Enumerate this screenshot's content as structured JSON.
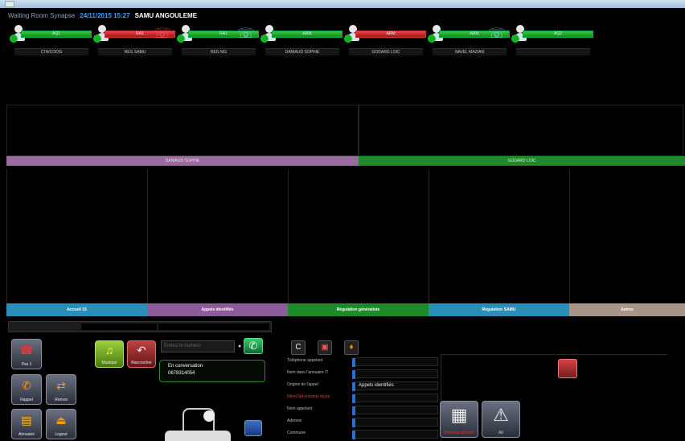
{
  "window": {
    "app_icon": "window-icon"
  },
  "header": {
    "room": "Waiting Room Synapse",
    "datetime": "24/11/2015 15:27",
    "center": "SAMU ANGOULEME"
  },
  "agents": [
    {
      "bar_label": "AQ1",
      "name": "CTA/CODIS",
      "status_color": "#1f9e1f",
      "phone_icon": ""
    },
    {
      "bar_label": "RA1",
      "name": "REG SAMU",
      "status_color": "#c02020",
      "phone_icon": "handset-icon"
    },
    {
      "bar_label": "RA1",
      "name": "REG MG",
      "status_color": "#1f9e1f",
      "phone_icon": "handset-icon"
    },
    {
      "bar_label": "ARM",
      "name": "DANIAUD SOPHIE",
      "status_color": "#1f9e1f",
      "phone_icon": ""
    },
    {
      "bar_label": "ARM",
      "name": "GODARD LOIC",
      "status_color": "#c02020",
      "phone_icon": ""
    },
    {
      "bar_label": "ARM",
      "name": "NAVEL MAZIAN",
      "status_color": "#1f9e1f",
      "phone_icon": "handset-icon"
    },
    {
      "bar_label": "AQ2",
      "name": "",
      "status_color": "#1f9e1f",
      "phone_icon": ""
    }
  ],
  "group_bars": [
    {
      "label": "DANIAUD SOPHIE",
      "color": "#9a6aa0"
    },
    {
      "label": "GODARD LOIC",
      "color": "#1e8a2a"
    }
  ],
  "queues": [
    {
      "label": "Accueil 15",
      "color": "#2a8fb8"
    },
    {
      "label": "Appels identifiés",
      "color": "#8c5c9a"
    },
    {
      "label": "Régulation généraliste",
      "color": "#1e8a2a"
    },
    {
      "label": "Régulation SAMU",
      "color": "#2a8fb8"
    },
    {
      "label": "Autres",
      "color": "#a8958a"
    }
  ],
  "left_buttons": [
    {
      "label": "Pas 1",
      "icon": "headset-icon"
    },
    {
      "label": "Rappel",
      "icon": "phone-icon"
    },
    {
      "label": "Renvoi",
      "icon": "transfer-icon"
    },
    {
      "label": "Annuaire",
      "icon": "directory-icon"
    },
    {
      "label": "Logout",
      "icon": "logout-icon"
    }
  ],
  "call_buttons": [
    {
      "label": "Musique",
      "icon": "music-icon"
    },
    {
      "label": "Raccrocher",
      "icon": "hangup-icon"
    }
  ],
  "dialer": {
    "placeholder": "Entrez le numéro"
  },
  "conversation": {
    "status": "En conversation",
    "number": "0678314054"
  },
  "toolbar": {
    "tools": [
      {
        "icon": "c-icon",
        "glyph": "C"
      },
      {
        "icon": "card-icon",
        "glyph": "▣"
      },
      {
        "icon": "person-alert-icon",
        "glyph": "♦"
      }
    ]
  },
  "form": {
    "fields": [
      {
        "label": "Téléphone appelant",
        "value": "",
        "label_red": false
      },
      {
        "label": "Nom dans l'annuaire IT",
        "value": "",
        "label_red": false
      },
      {
        "label": "Origine de l'appel",
        "value": "Appels identifiés",
        "label_red": false
      },
      {
        "label": "Nbre/Jalt entrants reçus",
        "value": "",
        "label_red": true
      },
      {
        "label": "Nom appelant",
        "value": "",
        "label_red": false
      },
      {
        "label": "Adresse",
        "value": "",
        "label_red": false
      },
      {
        "label": "Commune",
        "value": "",
        "label_red": false
      }
    ]
  },
  "actions": {
    "create_folder": "Nouveau dossier",
    "alarm": "Alt"
  }
}
